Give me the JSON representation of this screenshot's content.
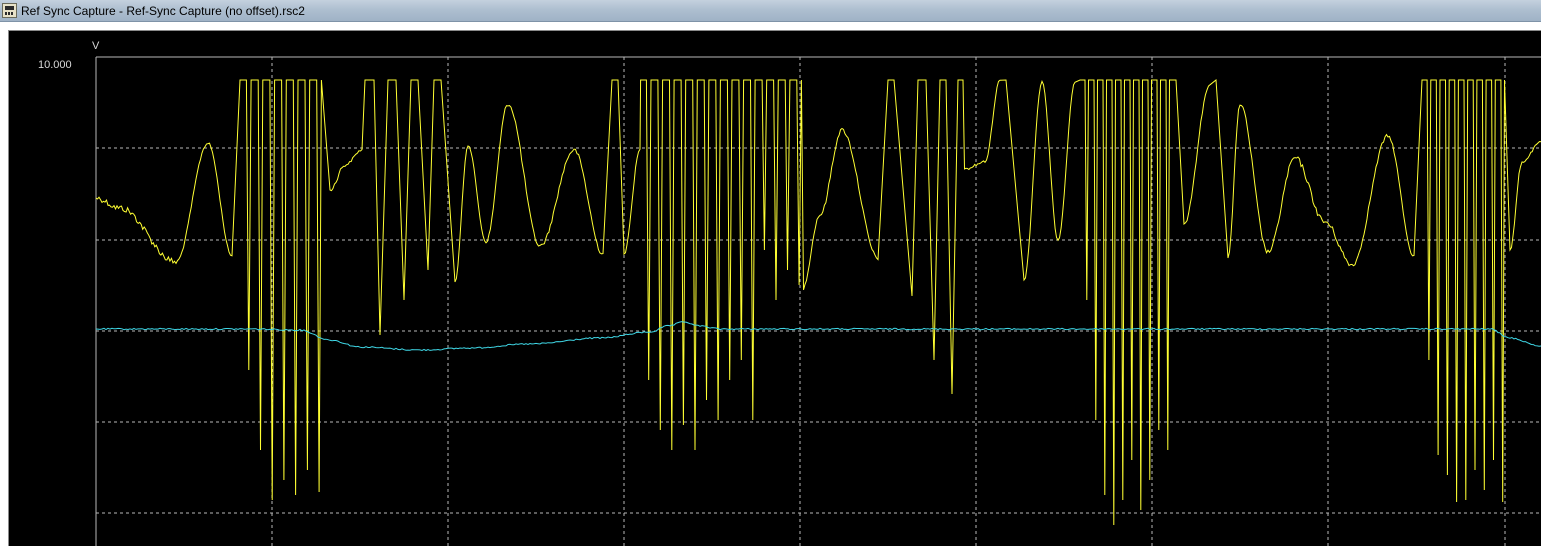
{
  "window": {
    "title": "Ref Sync Capture - Ref-Sync Capture (no offset).rsc2",
    "icon": "app-window-icon"
  },
  "plot": {
    "unit": "V",
    "y_top_label": "10.000"
  },
  "colors": {
    "background": "#000000",
    "grid": "#b8b8b8",
    "trace_ref": "#ffff33",
    "trace_sync": "#3fd7e6"
  },
  "chart_data": {
    "type": "line",
    "yunit": "V",
    "ytick_labels": [
      "10.000"
    ],
    "grid": true,
    "series": [
      {
        "trace": "yellow",
        "points": [
          [
            0,
            0.52
          ],
          [
            2.6,
            0.58
          ],
          [
            3.6,
            0.49
          ],
          [
            4.8,
            0.22
          ],
          [
            5.4,
            0.12
          ],
          [
            5.6,
            0.16
          ],
          [
            6.2,
            0.61
          ],
          [
            6.7,
            0.75
          ],
          [
            7.1,
            0.64
          ],
          [
            7.5,
            0.15
          ],
          [
            7.7,
            0.05
          ],
          [
            7.8,
            0.3
          ],
          [
            8.0,
            0.85
          ],
          [
            8.2,
            0.95
          ],
          [
            8.6,
            0.88
          ],
          [
            9.0,
            0.98
          ],
          [
            9.4,
            0.8
          ],
          [
            9.7,
            0.95
          ],
          [
            10.0,
            0.7
          ],
          [
            10.5,
            0.85
          ]
        ]
      },
      {
        "trace": "cyan",
        "points": [
          [
            0,
            0.01
          ],
          [
            5.0,
            0.0
          ],
          [
            6.2,
            -0.01
          ],
          [
            8.0,
            0.0
          ],
          [
            9.5,
            -0.01
          ],
          [
            10.5,
            -0.06
          ]
        ]
      }
    ]
  }
}
